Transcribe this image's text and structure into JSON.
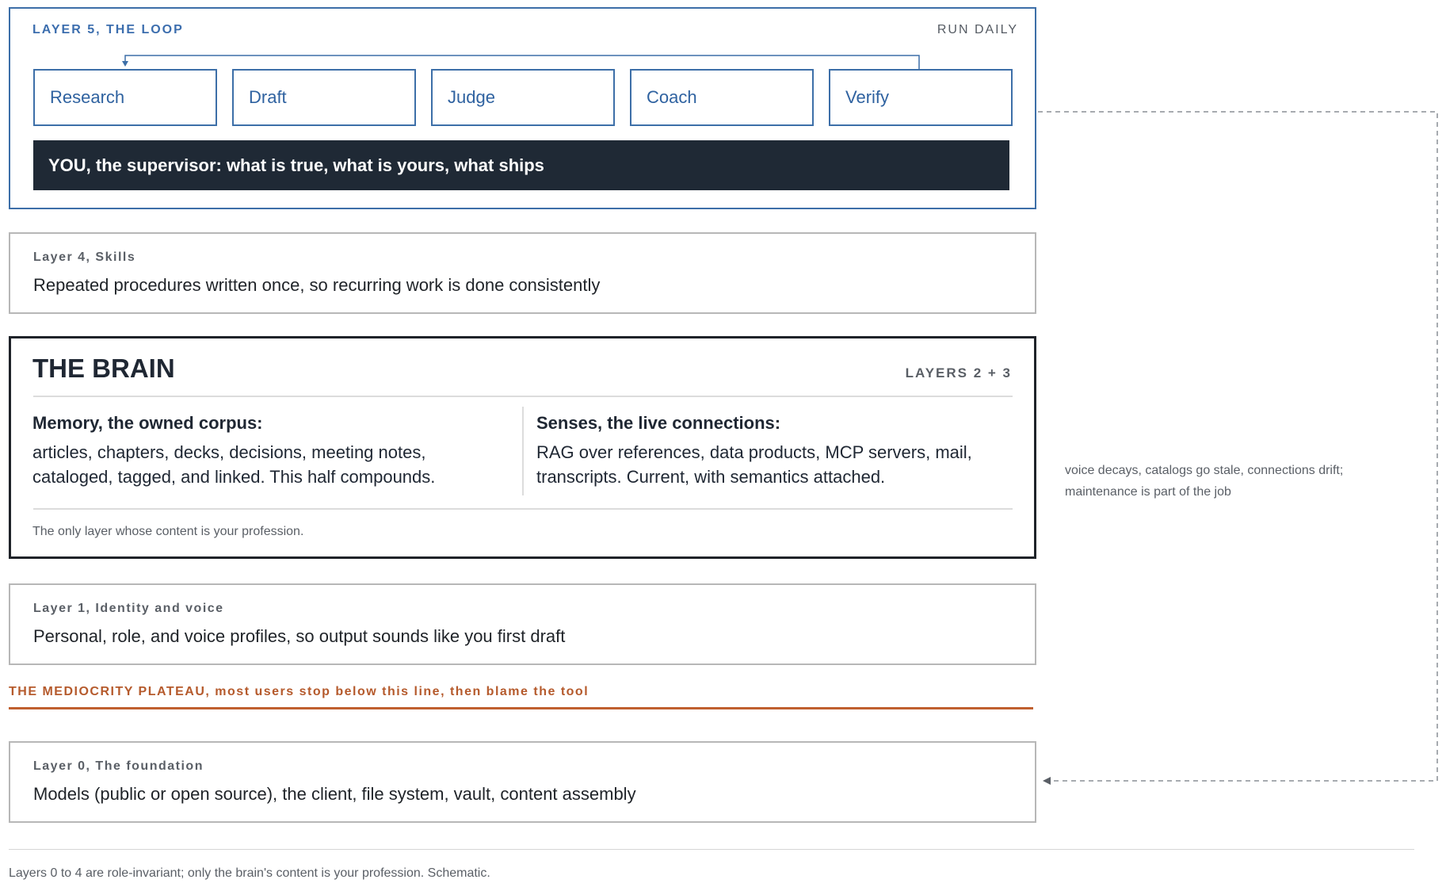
{
  "loop": {
    "title": "LAYER 5, THE LOOP",
    "run": "RUN DAILY",
    "steps": [
      "Research",
      "Draft",
      "Judge",
      "Coach",
      "Verify"
    ],
    "supervisor": "YOU, the supervisor: what is true, what is yours, what ships"
  },
  "layer4": {
    "label": "Layer 4, Skills",
    "text": "Repeated procedures written once, so recurring work is done consistently"
  },
  "brain": {
    "title": "THE BRAIN",
    "layers": "LAYERS 2 + 3",
    "memory_title": "Memory, the owned corpus:",
    "memory_body": "articles, chapters, decks, decisions, meeting notes, cataloged, tagged, and linked. This half compounds.",
    "senses_title": "Senses, the live connections:",
    "senses_body": "RAG over references, data products, MCP servers, mail, transcripts. Current, with semantics attached.",
    "footnote": "The only layer whose content is your profession."
  },
  "layer1": {
    "label": "Layer 1, Identity and voice",
    "text": "Personal, role, and voice profiles, so output sounds like you first draft"
  },
  "plateau": {
    "text": "THE MEDIOCRITY PLATEAU, most users stop below this line, then blame the tool"
  },
  "layer0": {
    "label": "Layer 0, The foundation",
    "text": "Models (public or open source), the client, file system, vault, content assembly"
  },
  "side_note": "voice decays, catalogs go stale, connections drift; maintenance is part of the job",
  "footer": "Layers 0 to 4 are role-invariant; only the brain's content is your profession. Schematic.",
  "colors": {
    "loop_blue": "#3d6fa8",
    "dark": "#1f2935",
    "plateau_orange": "#c0602f",
    "muted_text": "#5a5f66"
  }
}
